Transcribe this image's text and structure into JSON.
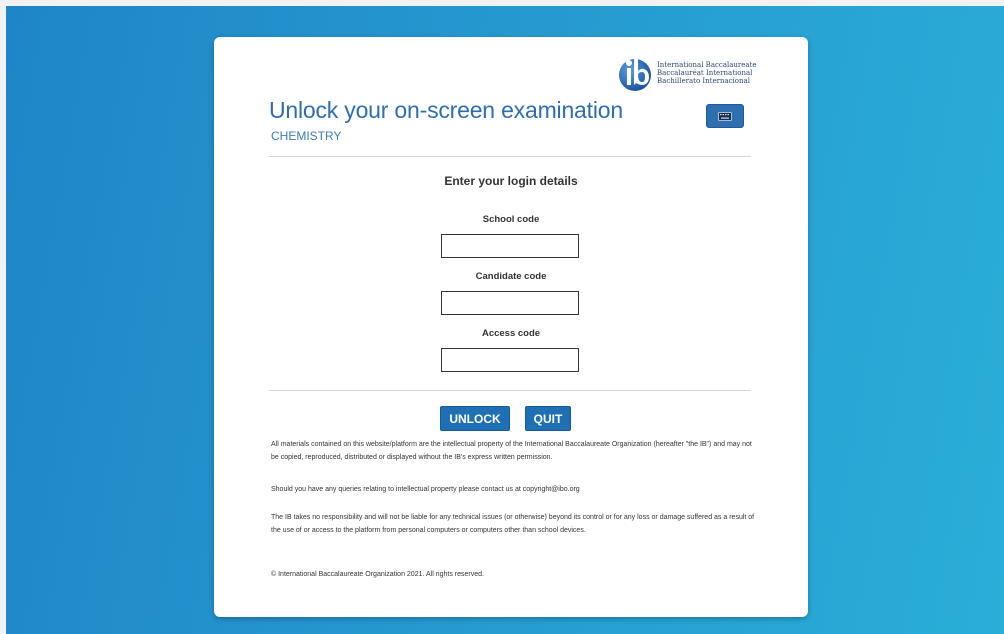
{
  "logo": {
    "lines": [
      "International Baccalaureate",
      "Baccalauréat International",
      "Bachillerato Internacional"
    ],
    "icon": "ib-logo"
  },
  "header": {
    "title": "Unlock your on-screen examination",
    "subject": "CHEMISTRY",
    "keyboard_icon": "keyboard-icon"
  },
  "form": {
    "heading": "Enter your login details",
    "fields": [
      {
        "label": "School code",
        "value": ""
      },
      {
        "label": "Candidate code",
        "value": ""
      },
      {
        "label": "Access code",
        "value": ""
      }
    ],
    "unlock_label": "UNLOCK",
    "quit_label": "QUIT"
  },
  "legal": {
    "paragraph1": "All materials contained on this website/platform are the intellectual property of the International Baccalaureate Organization (hereafter \"the IB\") and may not be copied, reproduced, distributed or displayed without the IB's express written permission.",
    "paragraph2": "Should you have any queries relating to intellectual property please contact us at copyright@ibo.org",
    "paragraph3": "The IB takes no responsibility and will not be liable for any technical issues (or otherwise) beyond its control or for any loss or damage suffered as a result of the use of or access to the platform from personal computers or computers other than school devices.",
    "copyright": "© International Baccalaureate Organization 2021. All rights reserved."
  },
  "colors": {
    "background_start": "#1e86c6",
    "background_end": "#2aaed8",
    "button": "#1f6fb5",
    "title": "#2f6eac"
  }
}
